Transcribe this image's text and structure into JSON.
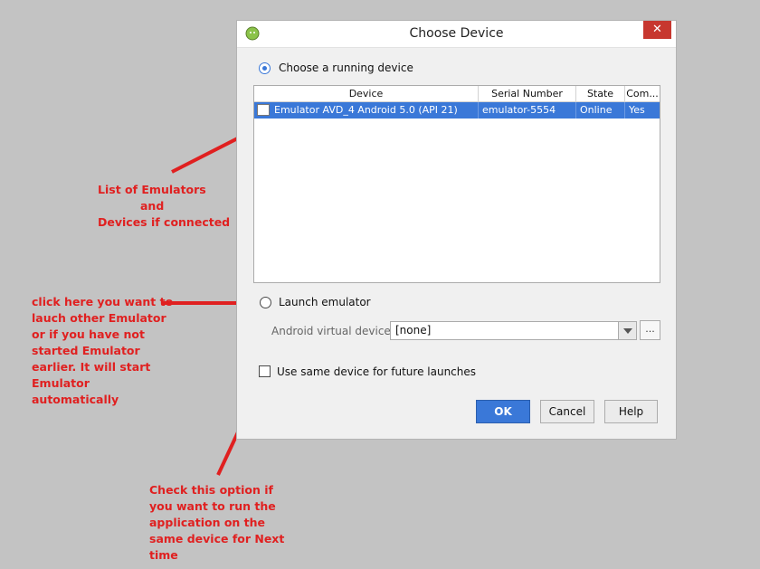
{
  "dialog": {
    "title": "Choose Device",
    "close_label": "✕",
    "running_device": {
      "label": "Choose a running device",
      "selected": true
    },
    "table": {
      "columns": [
        "Device",
        "Serial Number",
        "State",
        "Com..."
      ],
      "rows": [
        {
          "device": "Emulator AVD_4 Android 5.0 (API 21)",
          "serial": "emulator-5554",
          "state": "Online",
          "compatible": "Yes"
        }
      ]
    },
    "launch_emulator": {
      "label": "Launch emulator",
      "selected": false
    },
    "avd": {
      "label": "Android virtual device:",
      "value": "[none]",
      "more_label": "..."
    },
    "same_device": {
      "label": "Use same device for future launches",
      "checked": false
    },
    "buttons": {
      "ok": "OK",
      "cancel": "Cancel",
      "help": "Help"
    }
  },
  "annotations": {
    "emulators": [
      "List of Emulators",
      "and",
      "Devices if connected"
    ],
    "launch": [
      "click here you want to",
      "lauch other Emulator",
      "or if you have not",
      "started Emulator",
      "earlier. It will start",
      "Emulator",
      "automatically"
    ],
    "checkbox": [
      "Check this option if",
      "you want to run the",
      "application on the",
      "same device  for Next",
      "time"
    ]
  },
  "colors": {
    "accent": "#3a78d8",
    "annotation": "#e02020",
    "close": "#c7372f",
    "background": "#c3c3c3"
  },
  "icons": {
    "app": "android-icon",
    "row": "emulator-device-icon",
    "close": "close-icon",
    "dropdown": "chevron-down-icon"
  }
}
